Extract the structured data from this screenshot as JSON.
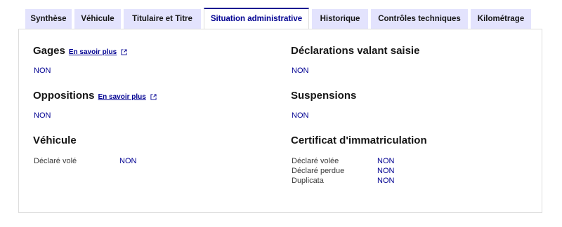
{
  "tabs": [
    {
      "label": "Synthèse",
      "active": false
    },
    {
      "label": "Véhicule",
      "active": false
    },
    {
      "label": "Titulaire et Titre",
      "active": false
    },
    {
      "label": "Situation administrative",
      "active": true
    },
    {
      "label": "Historique",
      "active": false
    },
    {
      "label": "Contrôles techniques",
      "active": false
    },
    {
      "label": "Kilométrage",
      "active": false
    }
  ],
  "gages": {
    "title": "Gages",
    "link": "En savoir plus",
    "value": "NON"
  },
  "oppositions": {
    "title": "Oppositions",
    "link": "En savoir plus",
    "value": "NON"
  },
  "vehicule": {
    "title": "Véhicule",
    "rows": [
      {
        "label": "Déclaré volé",
        "value": "NON"
      }
    ]
  },
  "declarations": {
    "title": "Déclarations valant saisie",
    "value": "NON"
  },
  "suspensions": {
    "title": "Suspensions",
    "value": "NON"
  },
  "certificat": {
    "title": "Certificat d'immatriculation",
    "rows": [
      {
        "label": "Déclaré volée",
        "value": "NON"
      },
      {
        "label": "Déclaré perdue",
        "value": "NON"
      },
      {
        "label": "Duplicata",
        "value": "NON"
      }
    ]
  },
  "colors": {
    "accent": "#000091",
    "tab_bg": "#e3e3fd",
    "border": "#dddddd"
  }
}
